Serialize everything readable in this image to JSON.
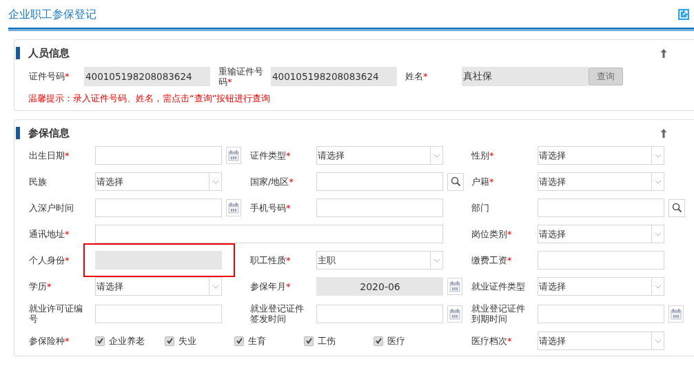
{
  "page": {
    "title": "企业职工参保登记"
  },
  "personnel": {
    "title": "人员信息",
    "expanded": true,
    "fields": [
      {
        "label": "证件号码",
        "marker": "*",
        "value": "400105198208083624"
      },
      {
        "label": "重输证件号码",
        "marker": "*",
        "value": "400105198208083624"
      },
      {
        "label": "姓名",
        "marker": "*",
        "value": "真社保"
      }
    ],
    "button": {
      "label": "查询",
      "disabled": true
    },
    "hint": "温馨提示：录入证件号码、姓名，需点击“查询”按钮进行查询"
  },
  "insurance": {
    "title": "参保信息",
    "expanded": true,
    "fields": [
      {
        "label": "出生日期",
        "marker": "*",
        "kind": "date"
      },
      {
        "label": "证件类型",
        "marker": "*",
        "kind": "select",
        "value": "请选择"
      },
      {
        "label": "性别",
        "marker": "*",
        "kind": "select",
        "value": "请选择"
      },
      {
        "label": "民族",
        "kind": "select",
        "value": "请选择"
      },
      {
        "label": "国家/地区",
        "marker": "*",
        "kind": "search"
      },
      {
        "label": "户籍",
        "marker": "*",
        "kind": "select",
        "value": "请选择"
      },
      {
        "label": "入深户时间",
        "kind": "date"
      },
      {
        "label": "手机号码",
        "marker": "*",
        "kind": "text"
      },
      {
        "label": "部门",
        "kind": "search"
      },
      {
        "label": "通讯地址",
        "marker": "*",
        "kind": "wide"
      },
      {
        "label": "岗位类别",
        "marker": "*",
        "kind": "select",
        "value": "请选择"
      },
      {
        "label": "个人身份",
        "marker": "*",
        "kind": "readonly",
        "highlighted": true
      },
      {
        "label": "职工性质",
        "marker": "*",
        "kind": "select",
        "value": "主职"
      },
      {
        "label": "缴费工资",
        "marker": "*",
        "kind": "text"
      },
      {
        "label": "学历",
        "marker": "*",
        "kind": "select",
        "value": "请选择"
      },
      {
        "label": "参保年月",
        "marker": "*",
        "kind": "readonly-date",
        "value": "2020-06"
      },
      {
        "label": "就业证件类型",
        "kind": "select",
        "value": "请选择"
      },
      {
        "label": "就业许可证编号",
        "kind": "text"
      },
      {
        "label": "就业登记证件签发时间",
        "kind": "date"
      },
      {
        "label": "就业登记证件到期时间",
        "kind": "date"
      },
      {
        "label": "参保险种",
        "marker": "*",
        "kind": "checks",
        "items": [
          {
            "label": "企业养老",
            "checked": true
          },
          {
            "label": "失业",
            "checked": true
          },
          {
            "label": "生育",
            "checked": true
          },
          {
            "label": "工伤",
            "checked": true
          },
          {
            "label": "医疗",
            "checked": true
          }
        ]
      },
      {
        "label": "医疗档次",
        "marker": "*",
        "kind": "select",
        "value": "请选择"
      }
    ]
  }
}
